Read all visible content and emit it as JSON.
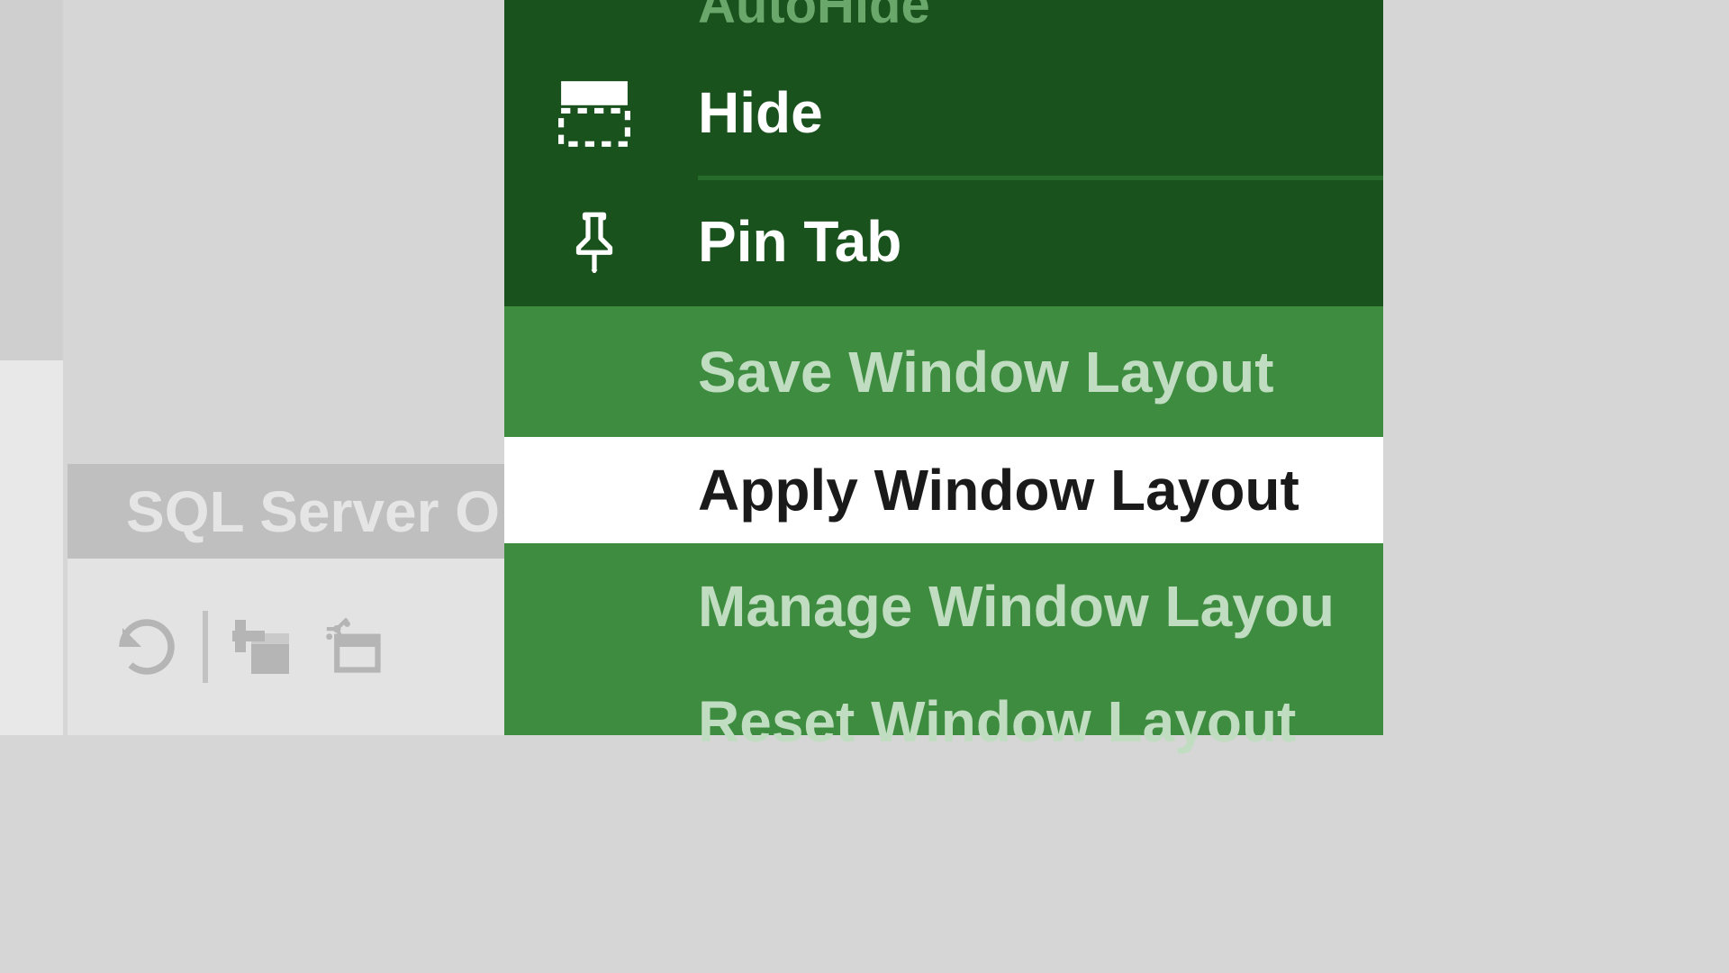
{
  "left": {
    "server_label": "SQL Server O"
  },
  "menu": {
    "autohide": "AutoHide",
    "hide": "Hide",
    "pin_tab": "Pin Tab",
    "save_layout": "Save Window Layout",
    "apply_layout": "Apply Window Layout",
    "manage_layout": "Manage Window Layou",
    "reset_layout": "Reset Window Layout"
  }
}
